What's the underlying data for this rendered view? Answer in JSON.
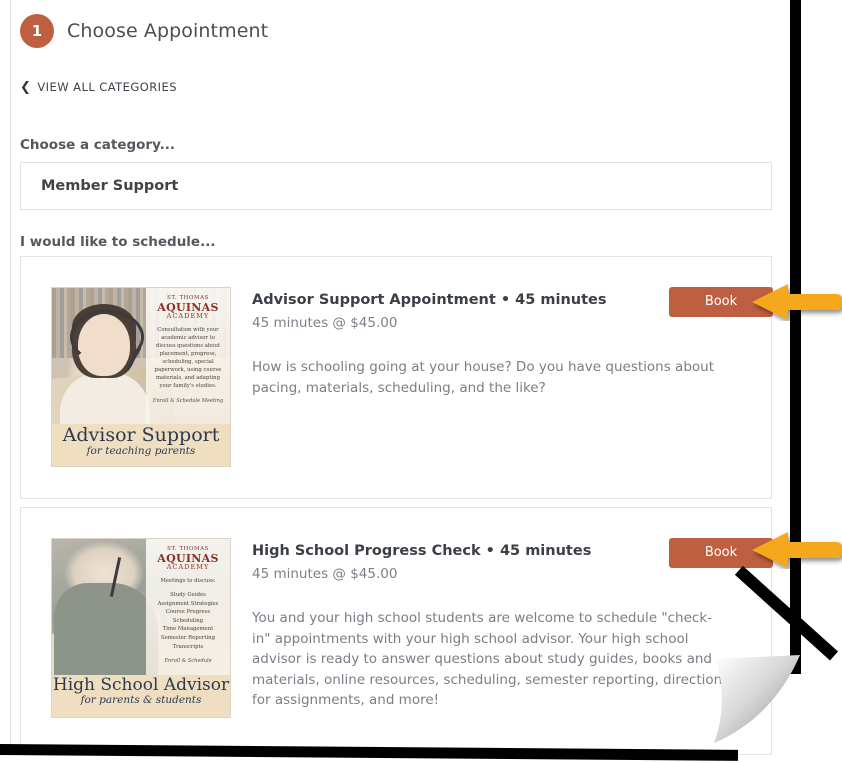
{
  "step": {
    "number": "1",
    "title": "Choose Appointment",
    "badge_color": "#bf5f41"
  },
  "back_link": {
    "chevron": "chevron-left-icon",
    "label": "VIEW ALL CATEGORIES"
  },
  "category_section": {
    "label": "Choose a category...",
    "selected": "Member Support"
  },
  "schedule_section": {
    "label": "I would like to schedule..."
  },
  "appointments": [
    {
      "title": "Advisor Support Appointment • 45 minutes",
      "meta": "45 minutes @ $45.00",
      "description": "How is schooling going at your house? Do you have questions about pacing, materials, scheduling, and the like?",
      "book_label": "Book",
      "flyer": {
        "brand_line1": "ST. THOMAS",
        "brand_line2": "AQUINAS",
        "brand_line3": "ACADEMY",
        "body": "Consultation with your academic advisor to discuss questions about placement, progress, scheduling, special paperwork, using course materials, and adapting your family's studies.",
        "footer": "Enroll & Schedule Meeting",
        "band_title": "Advisor Support",
        "band_subtitle": "for teaching parents"
      }
    },
    {
      "title": "High School Progress Check • 45 minutes",
      "meta": "45 minutes @ $45.00",
      "description": "You and your high school students are welcome to schedule \"check-in\" appointments with your high school advisor. Your high school advisor is ready to answer questions about study guides, books and materials, online resources, scheduling, semester reporting, directions for assignments, and more!",
      "book_label": "Book",
      "flyer": {
        "brand_line1": "ST. THOMAS",
        "brand_line2": "AQUINAS",
        "brand_line3": "ACADEMY",
        "body": "Meetings to discuss:",
        "list": "Study Guides\nAssignment Strategies\nCourse Progress\nScheduling\nTime Management\nSemester Reporting\nTranscripts",
        "footer": "Enroll & Schedule",
        "band_title": "High School Advisor",
        "band_subtitle": "for parents & students"
      }
    }
  ],
  "annotations": {
    "arrow_color": "#F5A81C",
    "arrow_1_name": "callout-arrow-book-advisor-support",
    "arrow_2_name": "callout-arrow-book-high-school"
  }
}
